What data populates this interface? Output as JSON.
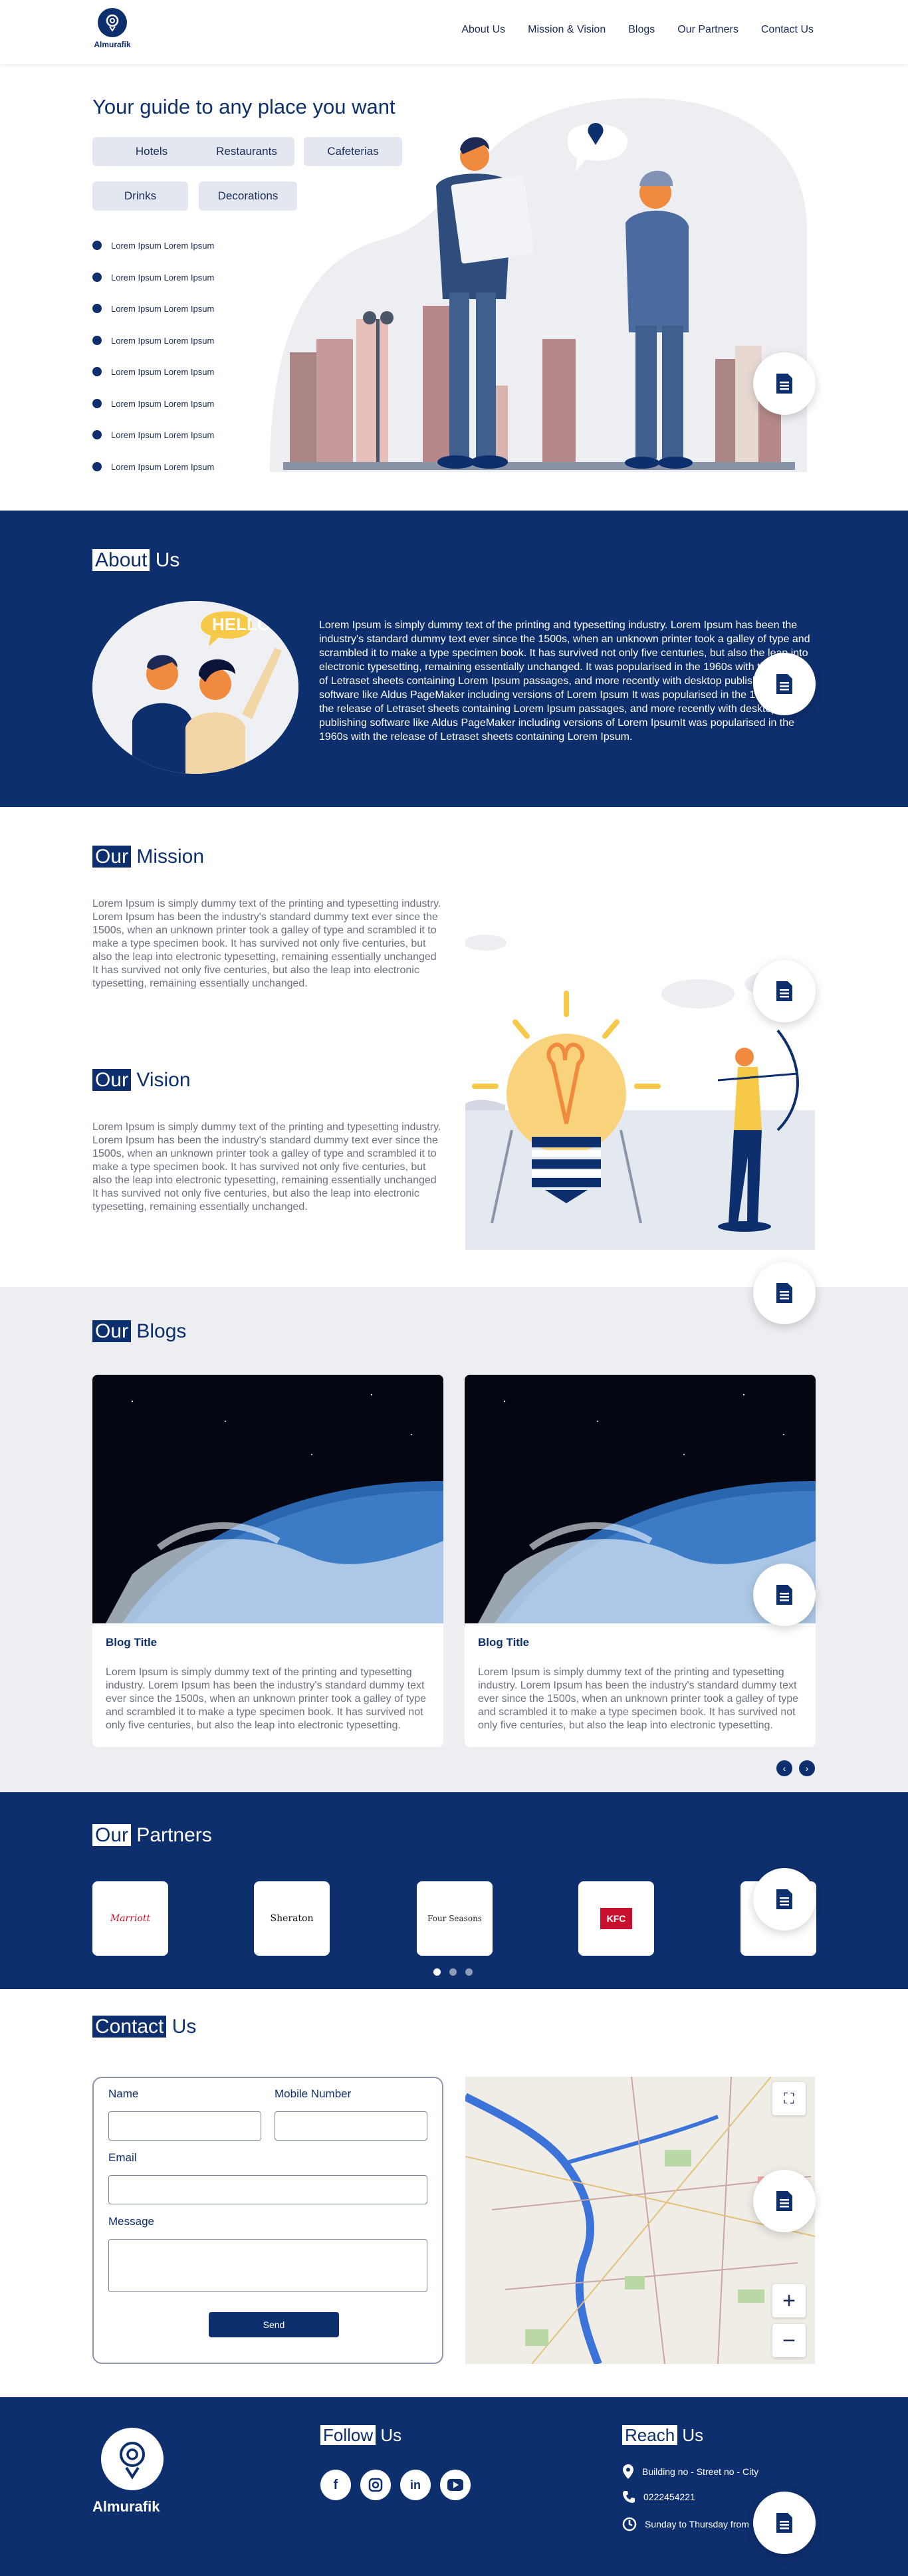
{
  "brand": {
    "name": "Almurafik"
  },
  "nav": {
    "items": [
      "About Us",
      "Mission & Vision",
      "Blogs",
      "Our Partners",
      "Contact Us"
    ]
  },
  "hero": {
    "title": "Your guide to any place you want",
    "chips": [
      "Hotels",
      "Restaurants",
      "Cafeterias",
      "Drinks",
      "Decorations"
    ],
    "list": [
      "Lorem Ipsum Lorem Ipsum",
      "Lorem Ipsum Lorem Ipsum",
      "Lorem Ipsum Lorem Ipsum",
      "Lorem Ipsum Lorem Ipsum",
      "Lorem Ipsum Lorem Ipsum",
      "Lorem Ipsum Lorem Ipsum",
      "Lorem Ipsum Lorem Ipsum",
      "Lorem Ipsum Lorem Ipsum"
    ]
  },
  "about": {
    "title_hl": "About",
    "title_rest": "Us",
    "bubble": "HELLO!",
    "text": "Lorem Ipsum is simply dummy text of the printing and typesetting industry. Lorem Ipsum has been the industry's standard dummy text ever since the 1500s, when an unknown printer took a galley of type and scrambled it to make a type specimen book. It has survived not only five centuries, but also the leap into electronic typesetting, remaining essentially unchanged. It was popularised in the 1960s with the release of Letraset sheets containing Lorem Ipsum passages, and more recently with desktop publishing software like Aldus PageMaker including versions of Lorem Ipsum It was popularised in the 1960s with the release of Letraset sheets containing Lorem Ipsum passages, and more recently with desktop publishing software like Aldus PageMaker including versions of Lorem IpsumIt was popularised in the 1960s with the release of Letraset sheets containing Lorem Ipsum."
  },
  "mission": {
    "title_hl": "Our",
    "title_rest": "Mission",
    "text": "Lorem Ipsum is simply dummy text of the printing and typesetting industry. Lorem Ipsum has been the industry's standard dummy text ever since the 1500s, when an unknown printer took a galley of type and scrambled it to make a type specimen book. It has survived not only five centuries, but also the leap into electronic typesetting, remaining essentially unchanged It has survived not only five centuries, but also the leap into electronic typesetting, remaining essentially unchanged."
  },
  "vision": {
    "title_hl": "Our",
    "title_rest": "Vision",
    "text": "Lorem Ipsum is simply dummy text of the printing and typesetting industry. Lorem Ipsum has been the industry's standard dummy text ever since the 1500s, when an unknown printer took a galley of type and scrambled it to make a type specimen book. It has survived not only five centuries, but also the leap into electronic typesetting, remaining essentially unchanged It has survived not only five centuries, but also the leap into electronic typesetting, remaining essentially unchanged."
  },
  "blogs": {
    "title_hl": "Our",
    "title_rest": "Blogs",
    "cards": [
      {
        "title": "Blog Title",
        "text": "Lorem Ipsum is simply dummy text of the printing and typesetting industry. Lorem Ipsum has been the industry's standard dummy text ever since the 1500s, when an unknown printer took a galley of type and scrambled it to make a type specimen book. It has survived not only five centuries, but also the leap into electronic typesetting."
      },
      {
        "title": "Blog Title",
        "text": "Lorem Ipsum is simply dummy text of the printing and typesetting industry. Lorem Ipsum has been the industry's standard dummy text ever since the 1500s, when an unknown printer took a galley of type and scrambled it to make a type specimen book. It has survived not only five centuries, but also the leap into electronic typesetting."
      }
    ]
  },
  "partners": {
    "title_hl": "Our",
    "title_rest": "Partners",
    "logos": [
      "Marriott",
      "Sheraton",
      "Four Seasons",
      "KFC",
      ""
    ]
  },
  "contact": {
    "title_hl": "Contact",
    "title_rest": "Us",
    "labels": {
      "name": "Name",
      "mobile": "Mobile Number",
      "email": "Email",
      "message": "Message"
    },
    "send": "Send"
  },
  "footer": {
    "brand": "Almurafik",
    "follow_hl": "Follow",
    "follow_rest": "Us",
    "reach_hl": "Reach",
    "reach_rest": "Us",
    "address": "Building no - Street no - City",
    "phone": "0222454221",
    "hours": "Sunday to Thursday from"
  },
  "colors": {
    "primary": "#0e2f6e",
    "accent_orange": "#f08a3e",
    "bulb_yellow": "#f7c948",
    "light_bg": "#eceef2"
  },
  "icons": [
    "document-icon",
    "location-icon",
    "phone-icon",
    "clock-icon",
    "facebook-icon",
    "instagram-icon",
    "linkedin-icon",
    "youtube-icon"
  ]
}
